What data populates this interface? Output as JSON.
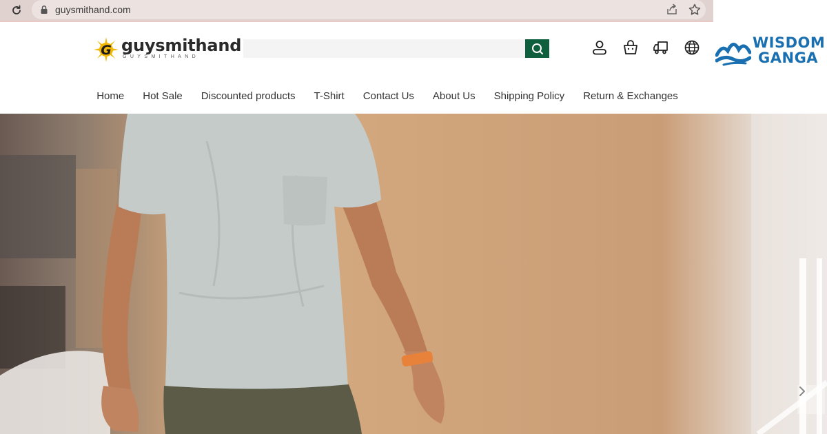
{
  "browser": {
    "url": "guysmithand.com"
  },
  "header": {
    "logo_text": "guysmithand",
    "logo_subtext": "GUYSMITHAND",
    "search": {
      "placeholder": "",
      "value": ""
    },
    "icons": [
      "search-icon",
      "account-icon",
      "cart-icon",
      "truck-icon",
      "globe-icon"
    ]
  },
  "watermark": {
    "line1": "WISDOM",
    "line2": "GANGA"
  },
  "nav": {
    "items": [
      {
        "label": "Home"
      },
      {
        "label": "Hot Sale"
      },
      {
        "label": "Discounted products"
      },
      {
        "label": "T-Shirt"
      },
      {
        "label": "Contact Us"
      },
      {
        "label": "About Us"
      },
      {
        "label": "Shipping Policy"
      },
      {
        "label": "Return & Exchanges"
      }
    ]
  },
  "colors": {
    "brand_green": "#0f5e3d",
    "watermark_blue": "#1a6fb0",
    "logo_yellow": "#f2b705"
  }
}
